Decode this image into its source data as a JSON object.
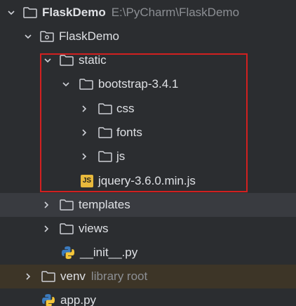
{
  "tree": {
    "root": {
      "label": "FlaskDemo",
      "path_hint": "E:\\PyCharm\\FlaskDemo",
      "expanded": true,
      "icon": "folder-icon"
    },
    "package": {
      "label": "FlaskDemo",
      "expanded": true,
      "icon": "package-folder-icon"
    },
    "static": {
      "label": "static",
      "expanded": true,
      "icon": "folder-icon"
    },
    "bootstrap": {
      "label": "bootstrap-3.4.1",
      "expanded": true,
      "icon": "folder-icon"
    },
    "css": {
      "label": "css",
      "expanded": false,
      "icon": "folder-icon"
    },
    "fonts": {
      "label": "fonts",
      "expanded": false,
      "icon": "folder-icon"
    },
    "js_folder": {
      "label": "js",
      "expanded": false,
      "icon": "folder-icon"
    },
    "jquery": {
      "label": "jquery-3.6.0.min.js",
      "icon": "javascript-file-icon",
      "badge": "JS"
    },
    "templates": {
      "label": "templates",
      "expanded": false,
      "icon": "folder-icon",
      "selected": true
    },
    "views": {
      "label": "views",
      "expanded": false,
      "icon": "folder-icon"
    },
    "init": {
      "label": "__init__.py",
      "icon": "python-file-icon"
    },
    "venv": {
      "label": "venv",
      "root_hint": "library root",
      "expanded": false,
      "icon": "folder-icon"
    },
    "app": {
      "label": "app.py",
      "icon": "python-file-icon"
    }
  },
  "colors": {
    "background": "#2b2d30",
    "selected_row": "#393b40",
    "excluded_row": "#3d3527",
    "text": "#dfe1e5",
    "hint_text": "#8c8f94",
    "highlight_border": "#d22020",
    "js_badge": "#e8b93c"
  }
}
